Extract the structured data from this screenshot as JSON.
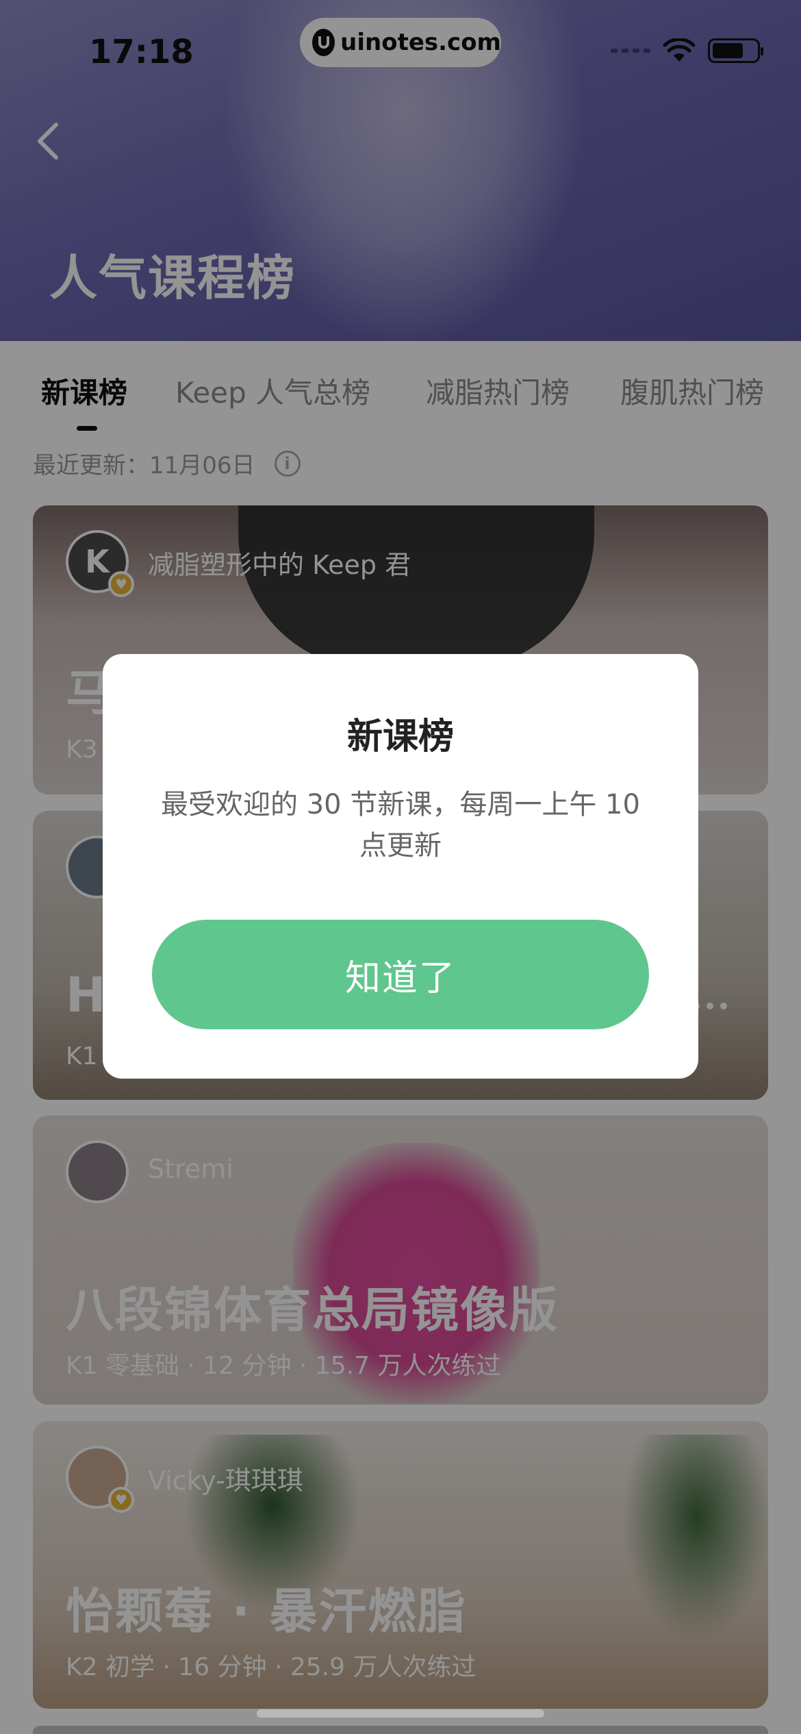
{
  "status_bar": {
    "time": "17:18",
    "watermark": "uinotes.com"
  },
  "header": {
    "title": "人气课程榜",
    "background_color": "#6e6ab2"
  },
  "tabs": [
    {
      "label": "新课榜",
      "active": true
    },
    {
      "label": "Keep 人气总榜",
      "active": false
    },
    {
      "label": "减脂热门榜",
      "active": false
    },
    {
      "label": "腹肌热门榜",
      "active": false
    }
  ],
  "update": {
    "text": "最近更新：11月06日",
    "icon": "info-icon"
  },
  "cards": [
    {
      "author": "减脂塑形中的 Keep 君",
      "title": "马",
      "meta": "K3",
      "verified": true
    },
    {
      "author": "",
      "title": "H",
      "meta": "K1",
      "verified": false
    },
    {
      "author": "Stremi",
      "title": "八段锦体育总局镜像版",
      "meta": "K1 零基础 · 12 分钟 · 15.7 万人次练过",
      "verified": false
    },
    {
      "author": "Vicky-琪琪琪",
      "title": "怡颗莓 · 暴汗燃脂",
      "meta": "K2 初学 · 16 分钟 · 25.9 万人次练过",
      "verified": true
    }
  ],
  "dialog": {
    "title": "新课榜",
    "description": "最受欢迎的 30 节新课，每周一上午 10 点更新",
    "button_label": "知道了",
    "button_color": "#5fc68d"
  }
}
